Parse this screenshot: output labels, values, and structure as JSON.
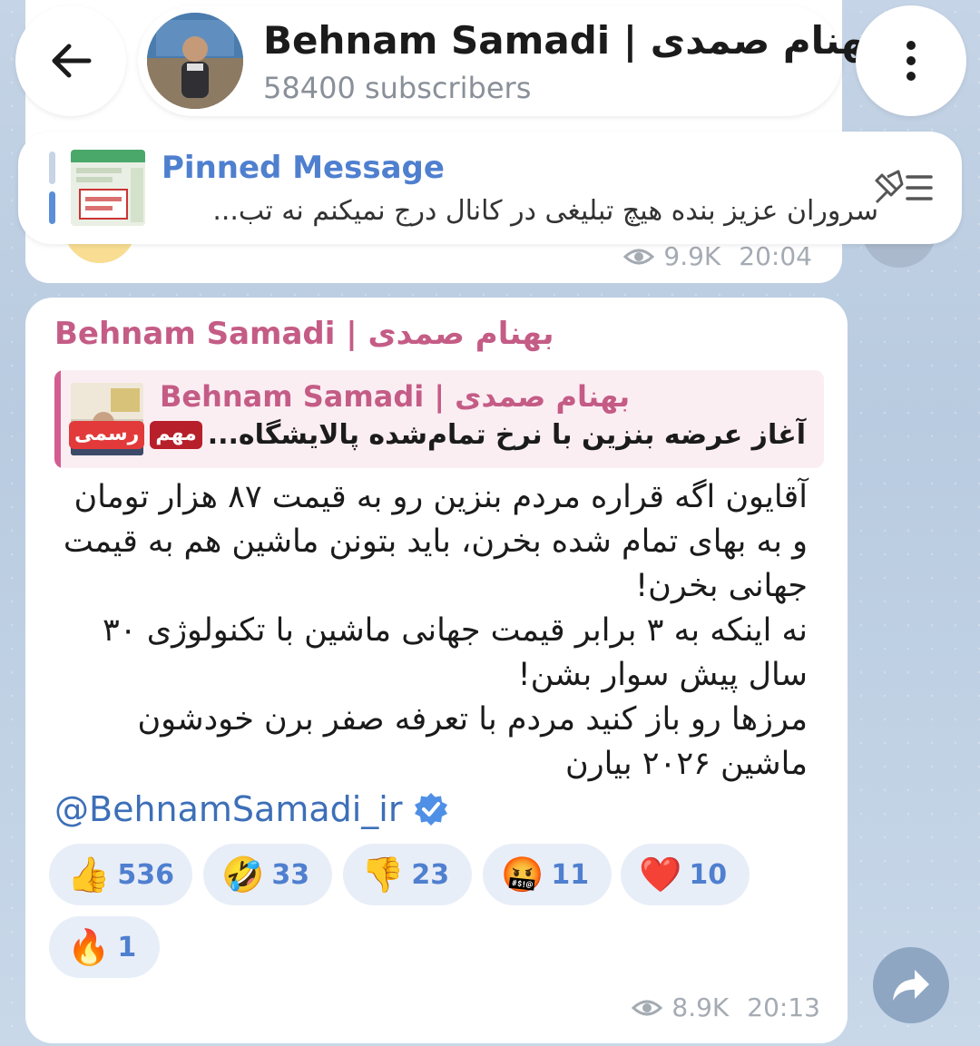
{
  "header": {
    "title": "Behnam Samadi | بهنام صمدی",
    "subscribers": "58400 subscribers"
  },
  "pinned": {
    "title": "Pinned Message",
    "text": "سروران عزیز  بنده هیچ تبلیغی در کانال درج نمیکنم نه تب..."
  },
  "previous_message": {
    "views": "9.9K",
    "time": "20:04"
  },
  "message": {
    "author": "Behnam Samadi | بهنام صمدی",
    "reply": {
      "author": "Behnam Samadi | بهنام صمدی",
      "badge1": "رسمی",
      "badge2": "مهم",
      "text": "آغاز عرضه بنزین با نرخ تمام‌شده پالایشگاه..."
    },
    "body": [
      "آقایون اگه قراره مردم بنزین رو به قیمت ۸۷ هزار تومان و به بهای تمام شده بخرن، باید بتونن ماشین هم به قیمت جهانی بخرن!",
      "نه اینکه به ۳ برابر قیمت جهانی ماشین با تکنولوژی ۳۰ سال پیش سوار بشن!",
      "مرزها رو باز کنید مردم با تعرفه صفر برن خودشون ماشین ۲۰۲۶ بیارن"
    ],
    "handle": "@BehnamSamadi_ir",
    "reactions": [
      {
        "emoji": "👍",
        "count": "536",
        "icon": "thumbs-up-icon"
      },
      {
        "emoji": "🤣",
        "count": "33",
        "icon": "rolling-laughing-icon"
      },
      {
        "emoji": "👎",
        "count": "23",
        "icon": "thumbs-down-icon"
      },
      {
        "emoji": "🤬",
        "count": "11",
        "icon": "cursing-face-icon"
      },
      {
        "emoji": "❤️",
        "count": "10",
        "icon": "heart-icon"
      },
      {
        "emoji": "🔥",
        "count": "1",
        "icon": "fire-icon"
      }
    ],
    "views": "8.9K",
    "time": "20:13"
  },
  "colors": {
    "accent_blue": "#4f7fcf",
    "author_pink": "#c45c86",
    "reaction_bg": "#e8eef8"
  }
}
